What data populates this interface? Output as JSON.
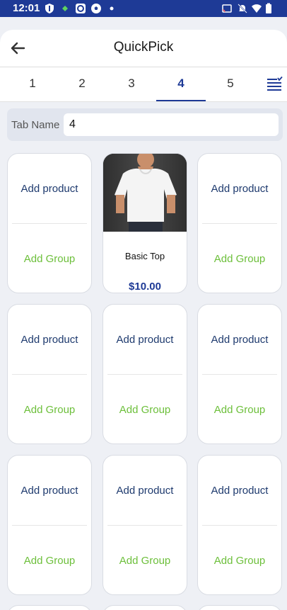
{
  "status": {
    "time": "12:01"
  },
  "header": {
    "title": "QuickPick"
  },
  "tabs": [
    {
      "label": "1"
    },
    {
      "label": "2"
    },
    {
      "label": "3"
    },
    {
      "label": "4",
      "active": true
    },
    {
      "label": "5"
    }
  ],
  "tab_name": {
    "label": "Tab Name",
    "value": "4"
  },
  "grid": {
    "add_product_label": "Add product",
    "add_group_label": "Add Group",
    "product": {
      "name": "Basic Top",
      "price": "$10.00"
    }
  },
  "colors": {
    "brand": "#1e3a96",
    "add_group": "#6cbf3a",
    "add_product": "#1e3a6e"
  }
}
